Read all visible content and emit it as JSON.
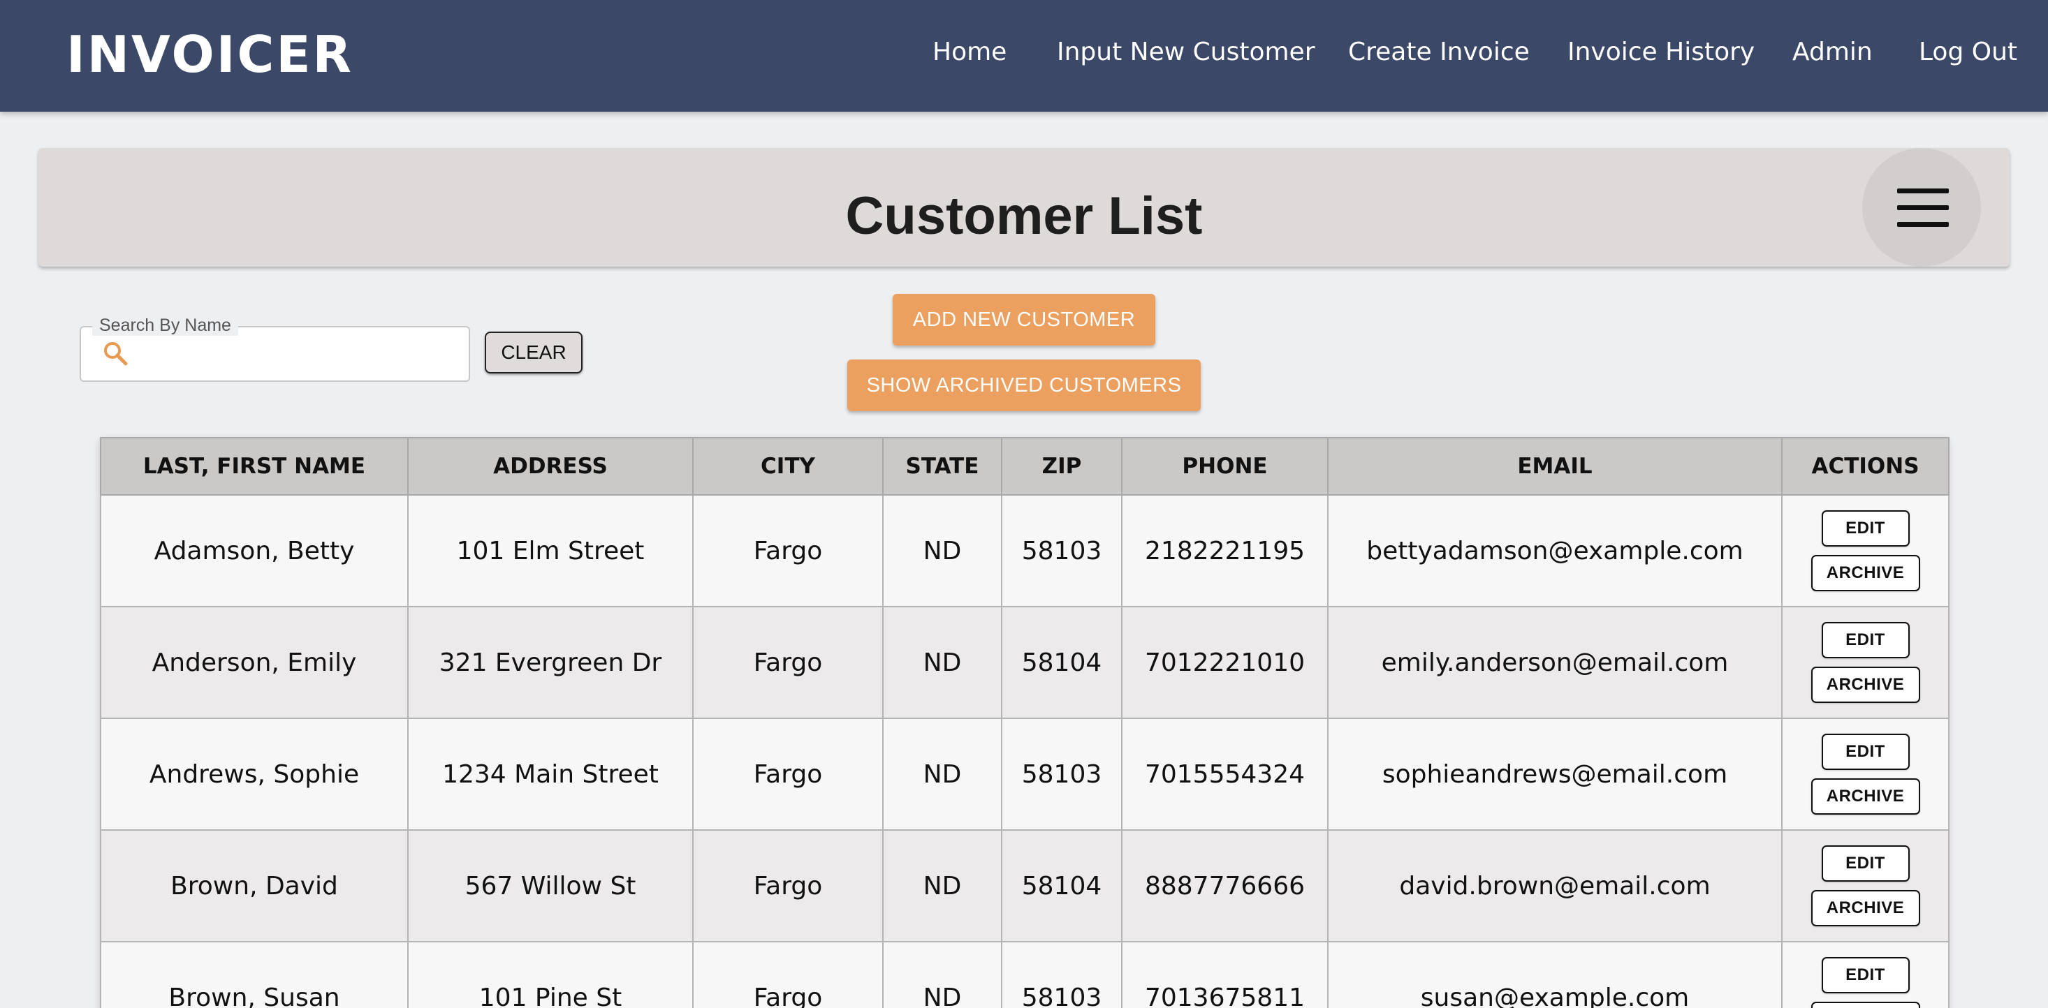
{
  "nav": {
    "brand": "INVOICER",
    "links": [
      "Home",
      "Input New Customer",
      "Create Invoice",
      "Invoice History",
      "Admin",
      "Log Out"
    ]
  },
  "header": {
    "title": "Customer List",
    "menu_icon": "hamburger-menu-icon"
  },
  "search": {
    "label": "Search By Name",
    "value": "",
    "placeholder": "",
    "icon": "search-icon",
    "clear_label": "CLEAR"
  },
  "buttons": {
    "add_customer": "ADD NEW CUSTOMER",
    "show_archived": "SHOW ARCHIVED CUSTOMERS"
  },
  "colors": {
    "nav_bg": "#3c4867",
    "accent": "#eca060",
    "header_card": "#dedad9"
  },
  "table": {
    "columns": [
      "LAST, FIRST NAME",
      "ADDRESS",
      "CITY",
      "STATE",
      "ZIP",
      "PHONE",
      "EMAIL",
      "ACTIONS"
    ],
    "action_labels": {
      "edit": "EDIT",
      "archive": "ARCHIVE"
    },
    "rows": [
      [
        "Adamson, Betty",
        "101 Elm Street",
        "Fargo",
        "ND",
        "58103",
        "2182221195",
        "bettyadamson@example.com"
      ],
      [
        "Anderson, Emily",
        "321 Evergreen Dr",
        "Fargo",
        "ND",
        "58104",
        "7012221010",
        "emily.anderson@email.com"
      ],
      [
        "Andrews, Sophie",
        "1234 Main Street",
        "Fargo",
        "ND",
        "58103",
        "7015554324",
        "sophieandrews@email.com"
      ],
      [
        "Brown, David",
        "567 Willow St",
        "Fargo",
        "ND",
        "58104",
        "8887776666",
        "david.brown@email.com"
      ],
      [
        "Brown, Susan",
        "101 Pine St",
        "Fargo",
        "ND",
        "58103",
        "7013675811",
        "susan@example.com"
      ]
    ]
  }
}
